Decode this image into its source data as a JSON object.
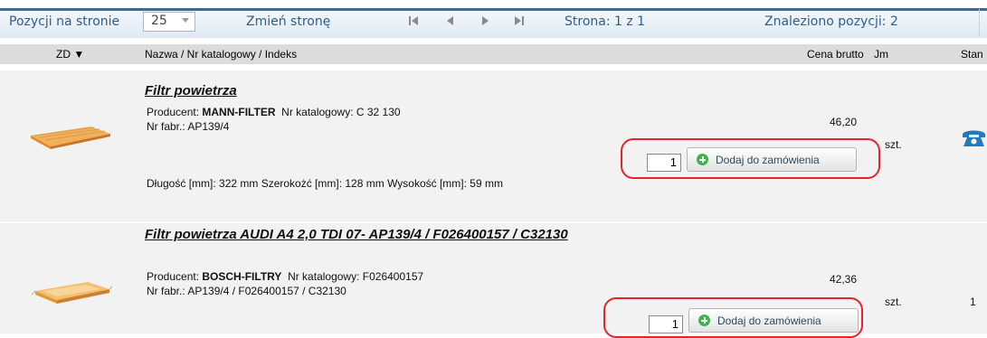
{
  "pagination": {
    "per_page_label": "Pozycji na stronie",
    "per_page_value": "25",
    "change_page_label": "Zmień stronę",
    "page_info": "Strona: 1 z 1",
    "found_info": "Znaleziono pozycji: 2"
  },
  "table": {
    "headers": {
      "zd": "ZD ▼",
      "name": "Nazwa  / Nr katalogowy  / Indeks",
      "price": "Cena brutto",
      "unit": "Jm",
      "stock": "Stan"
    },
    "rows": [
      {
        "title": "Filtr powietrza",
        "producer_label": "Producent:",
        "producer": "MANN-FILTER",
        "catalog_label": "Nr katalogowy:",
        "catalog": "C 32 130",
        "mfr_label": "Nr fabr.:",
        "mfr": "AP139/4",
        "dims": "Długość [mm]: 322 mm  Szerokożć [mm]: 128 mm  Wysokość [mm]: 59 mm",
        "price": "46,20",
        "unit": "szt.",
        "qty": "1",
        "add_label": "Dodaj do zamówienia",
        "stock_icon": "phone-icon"
      },
      {
        "title": "Filtr powietrza AUDI A4 2,0 TDI 07- AP139/4 / F026400157 / C32130",
        "producer_label": "Producent:",
        "producer": "BOSCH-FILTRY",
        "catalog_label": "Nr katalogowy:",
        "catalog": "F026400157",
        "mfr_label": "Nr fabr.:",
        "mfr": "AP139/4 / F026400157 / C32130",
        "price": "42,36",
        "unit": "szt.",
        "qty": "1",
        "add_label": "Dodaj do zamówienia",
        "stock": "1"
      }
    ]
  },
  "colors": {
    "accent_border": "#2b6fa8",
    "highlight": "#e8232a",
    "link_text": "#2d5f8c"
  }
}
